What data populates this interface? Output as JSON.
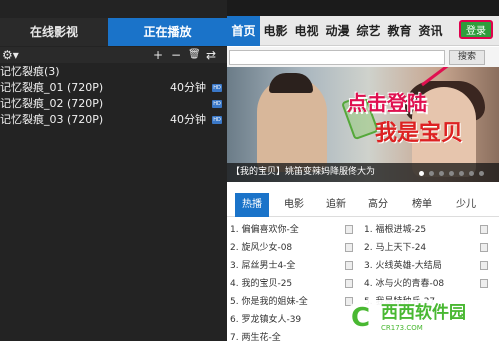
{
  "left_panel": {
    "tabs": {
      "online": "在线影视",
      "playing": "正在播放"
    },
    "toolbar": {
      "add": "+",
      "remove": "−",
      "delete": "🗑",
      "shuffle": "⇄"
    },
    "playlist": {
      "group": "记忆裂痕(3)",
      "items": [
        {
          "name": "记忆裂痕_01 (720P)",
          "duration": "40分钟",
          "badge": "HD"
        },
        {
          "name": "记忆裂痕_02 (720P)",
          "duration": "",
          "badge": "HD"
        },
        {
          "name": "记忆裂痕_03 (720P)",
          "duration": "40分钟",
          "badge": "HD"
        }
      ]
    }
  },
  "right_panel": {
    "categories": [
      "首页",
      "电影",
      "电视",
      "动漫",
      "综艺",
      "教育",
      "资讯"
    ],
    "login_label": "登录",
    "search": {
      "placeholder": "",
      "button": "搜索"
    },
    "banner": {
      "logo": "我是宝贝",
      "annotation": "点击登陆",
      "caption": "【我的宝贝】姚笛变辣妈降服佟大为"
    },
    "sub_tabs": [
      "热播",
      "电影",
      "追新",
      "高分",
      "榜单",
      "少儿"
    ],
    "rank_left": [
      "1. 偏偏喜欢你-全",
      "2. 旋风少女-08",
      "3. 屌丝男士4-全",
      "4. 我的宝贝-25",
      "5. 你是我的姐妹-全",
      "6. 罗龙镇女人-39",
      "7. 两生花-全"
    ],
    "rank_right": [
      "1. 福根进城-25",
      "2. 马上天下-24",
      "3. 火线英雄-大结局",
      "4. 冰与火的青春-08",
      "5. 我是特种兵-27"
    ]
  },
  "watermark": {
    "text": "西西软件园",
    "url": "CR173.COM"
  },
  "colors": {
    "accent": "#1a73c9",
    "login": "#2e9d3c",
    "annotation": "#e01050"
  }
}
